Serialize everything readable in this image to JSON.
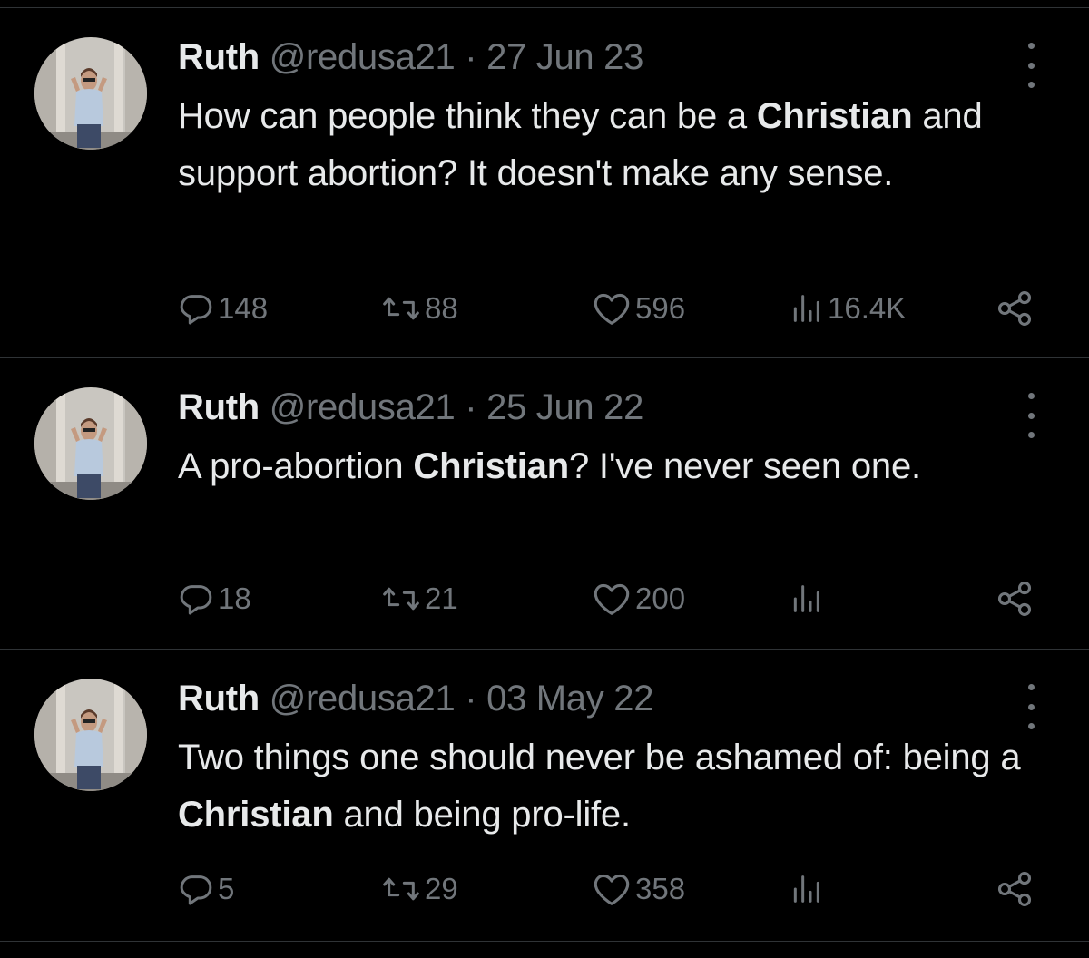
{
  "tweets": [
    {
      "name": "Ruth",
      "handle": "@redusa21",
      "separator": " · ",
      "date": "27 Jun 23",
      "text_parts": [
        {
          "text": "How can people think they can be a ",
          "bold": false
        },
        {
          "text": "Christian",
          "bold": true
        },
        {
          "text": " and support abortion? It doesn't make any sense.",
          "bold": false
        }
      ],
      "replies": "148",
      "retweets": "88",
      "likes": "596",
      "views": "16.4K"
    },
    {
      "name": "Ruth",
      "handle": "@redusa21",
      "separator": " · ",
      "date": "25 Jun 22",
      "text_parts": [
        {
          "text": "A pro-abortion ",
          "bold": false
        },
        {
          "text": "Christian",
          "bold": true
        },
        {
          "text": "? I've never seen one.",
          "bold": false
        }
      ],
      "replies": "18",
      "retweets": "21",
      "likes": "200",
      "views": ""
    },
    {
      "name": "Ruth",
      "handle": "@redusa21",
      "separator": " · ",
      "date": "03 May 22",
      "text_parts": [
        {
          "text": "Two things one should never be ashamed of: being a ",
          "bold": false
        },
        {
          "text": "Christian",
          "bold": true
        },
        {
          "text": " and being pro-life.",
          "bold": false
        }
      ],
      "replies": "5",
      "retweets": "29",
      "likes": "358",
      "views": ""
    }
  ],
  "icons": {
    "reply": "reply-icon",
    "retweet": "retweet-icon",
    "like": "heart-icon",
    "views": "views-icon",
    "share": "share-icon",
    "more": "more-icon"
  },
  "colors": {
    "background": "#000000",
    "text": "#e7e9ea",
    "muted": "#71767b",
    "divider": "#2f3336"
  }
}
